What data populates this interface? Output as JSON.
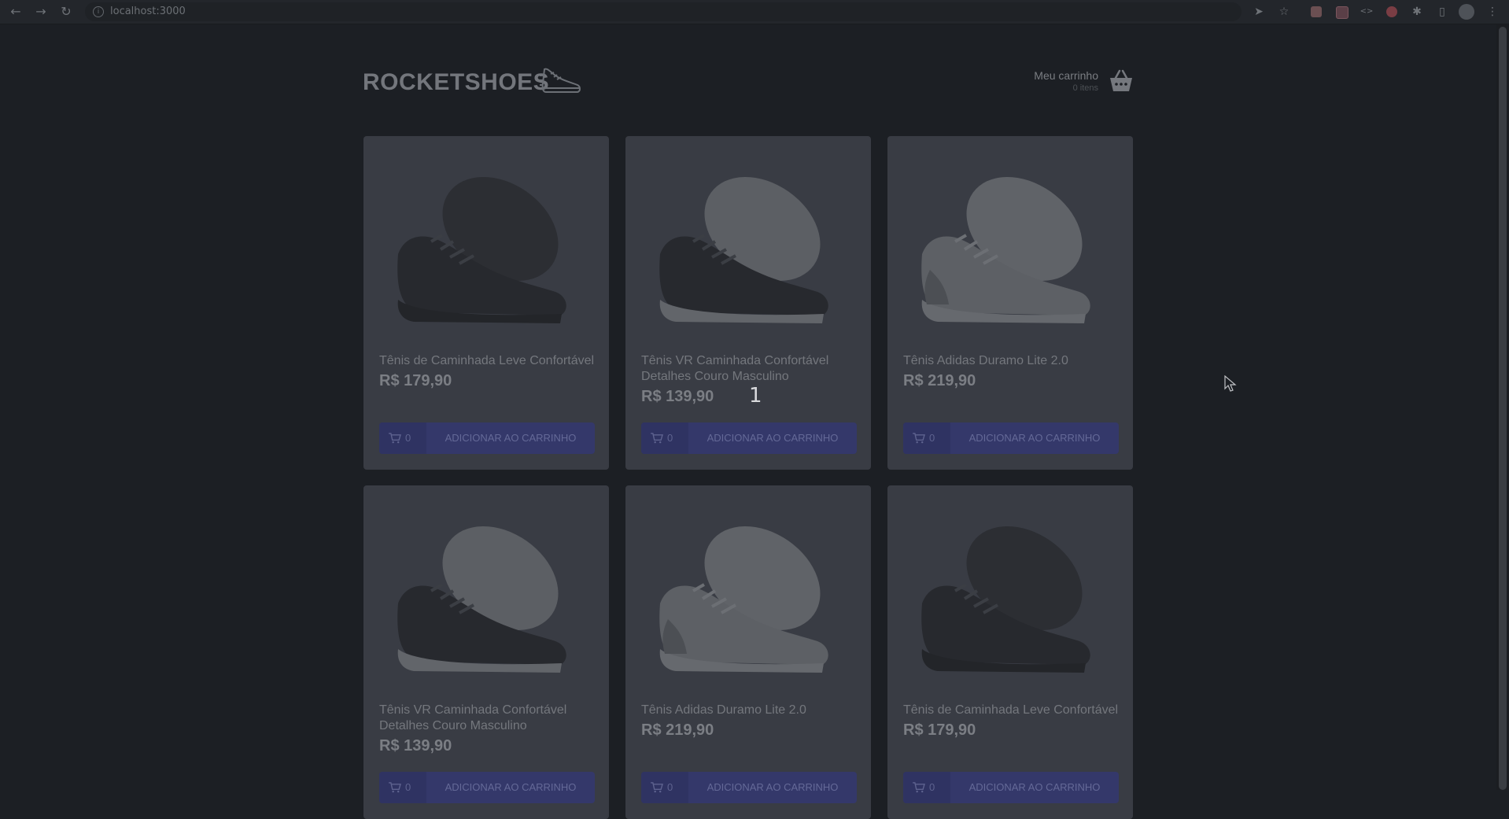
{
  "browser": {
    "url": "localhost:3000",
    "back": "←",
    "forward": "→",
    "reload": "↻",
    "info": "i",
    "send": "➤",
    "star": "☆",
    "puzzle": "✱",
    "sidebar": "▯",
    "menu": "⋮",
    "code": "<>"
  },
  "header": {
    "logo": "ROCKETSHOES",
    "cart_title": "Meu carrinho",
    "cart_count": "0 itens"
  },
  "products": [
    {
      "title": "Tênis de Caminhada Leve Confortável",
      "price": "R$ 179,90",
      "qty": "0",
      "button": "ADICIONAR AO CARRINHO",
      "shoe": "black"
    },
    {
      "title": "Tênis VR Caminhada Confortável Detalhes Couro Masculino",
      "price": "R$ 139,90",
      "qty": "0",
      "button": "ADICIONAR AO CARRINHO",
      "shoe": "black-white"
    },
    {
      "title": "Tênis Adidas Duramo Lite 2.0",
      "price": "R$ 219,90",
      "qty": "0",
      "button": "ADICIONAR AO CARRINHO",
      "shoe": "white"
    },
    {
      "title": "Tênis VR Caminhada Confortável Detalhes Couro Masculino",
      "price": "R$ 139,90",
      "qty": "0",
      "button": "ADICIONAR AO CARRINHO",
      "shoe": "black-white"
    },
    {
      "title": "Tênis Adidas Duramo Lite 2.0",
      "price": "R$ 219,90",
      "qty": "0",
      "button": "ADICIONAR AO CARRINHO",
      "shoe": "white"
    },
    {
      "title": "Tênis de Caminhada Leve Confortável",
      "price": "R$ 179,90",
      "qty": "0",
      "button": "ADICIONAR AO CARRINHO",
      "shoe": "black"
    }
  ],
  "overlay_number": "1",
  "colors": {
    "background": "#1c1f24",
    "card": "#393c44",
    "button": "#34386a"
  }
}
